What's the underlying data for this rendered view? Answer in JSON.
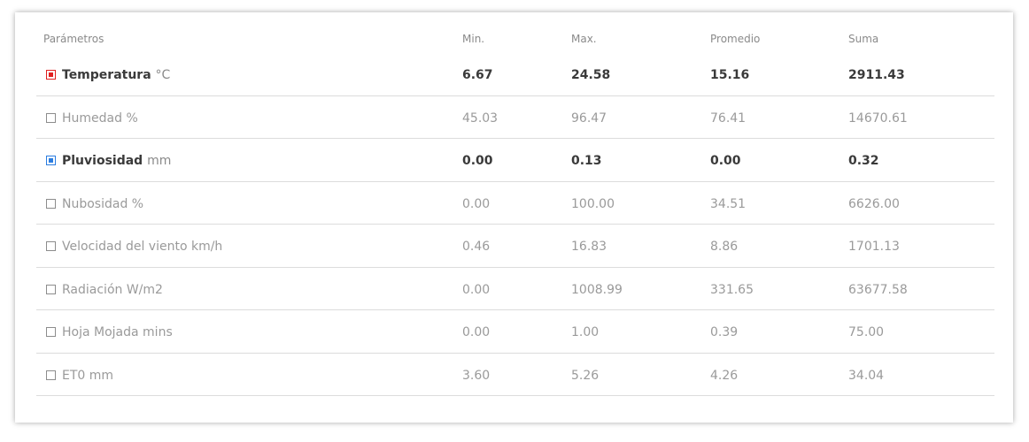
{
  "table": {
    "headers": {
      "param": "Parámetros",
      "min": "Min.",
      "max": "Max.",
      "avg": "Promedio",
      "sum": "Suma"
    },
    "rows": [
      {
        "name": "Temperatura",
        "unit": "°C",
        "min": "6.67",
        "max": "24.58",
        "avg": "15.16",
        "sum": "2911.43",
        "checked": true,
        "color": "#e02020"
      },
      {
        "name": "Humedad",
        "unit": "%",
        "min": "45.03",
        "max": "96.47",
        "avg": "76.41",
        "sum": "14670.61",
        "checked": false,
        "color": "#8c8c8c"
      },
      {
        "name": "Pluviosidad",
        "unit": "mm",
        "min": "0.00",
        "max": "0.13",
        "avg": "0.00",
        "sum": "0.32",
        "checked": true,
        "color": "#2b7de0"
      },
      {
        "name": "Nubosidad",
        "unit": "%",
        "min": "0.00",
        "max": "100.00",
        "avg": "34.51",
        "sum": "6626.00",
        "checked": false,
        "color": "#8c8c8c"
      },
      {
        "name": "Velocidad del viento",
        "unit": "km/h",
        "min": "0.46",
        "max": "16.83",
        "avg": "8.86",
        "sum": "1701.13",
        "checked": false,
        "color": "#8c8c8c"
      },
      {
        "name": "Radiación",
        "unit": "W/m2",
        "min": "0.00",
        "max": "1008.99",
        "avg": "331.65",
        "sum": "63677.58",
        "checked": false,
        "color": "#8c8c8c"
      },
      {
        "name": "Hoja Mojada",
        "unit": "mins",
        "min": "0.00",
        "max": "1.00",
        "avg": "0.39",
        "sum": "75.00",
        "checked": false,
        "color": "#8c8c8c"
      },
      {
        "name": "ET0",
        "unit": "mm",
        "min": "3.60",
        "max": "5.26",
        "avg": "4.26",
        "sum": "34.04",
        "checked": false,
        "color": "#8c8c8c"
      }
    ]
  }
}
